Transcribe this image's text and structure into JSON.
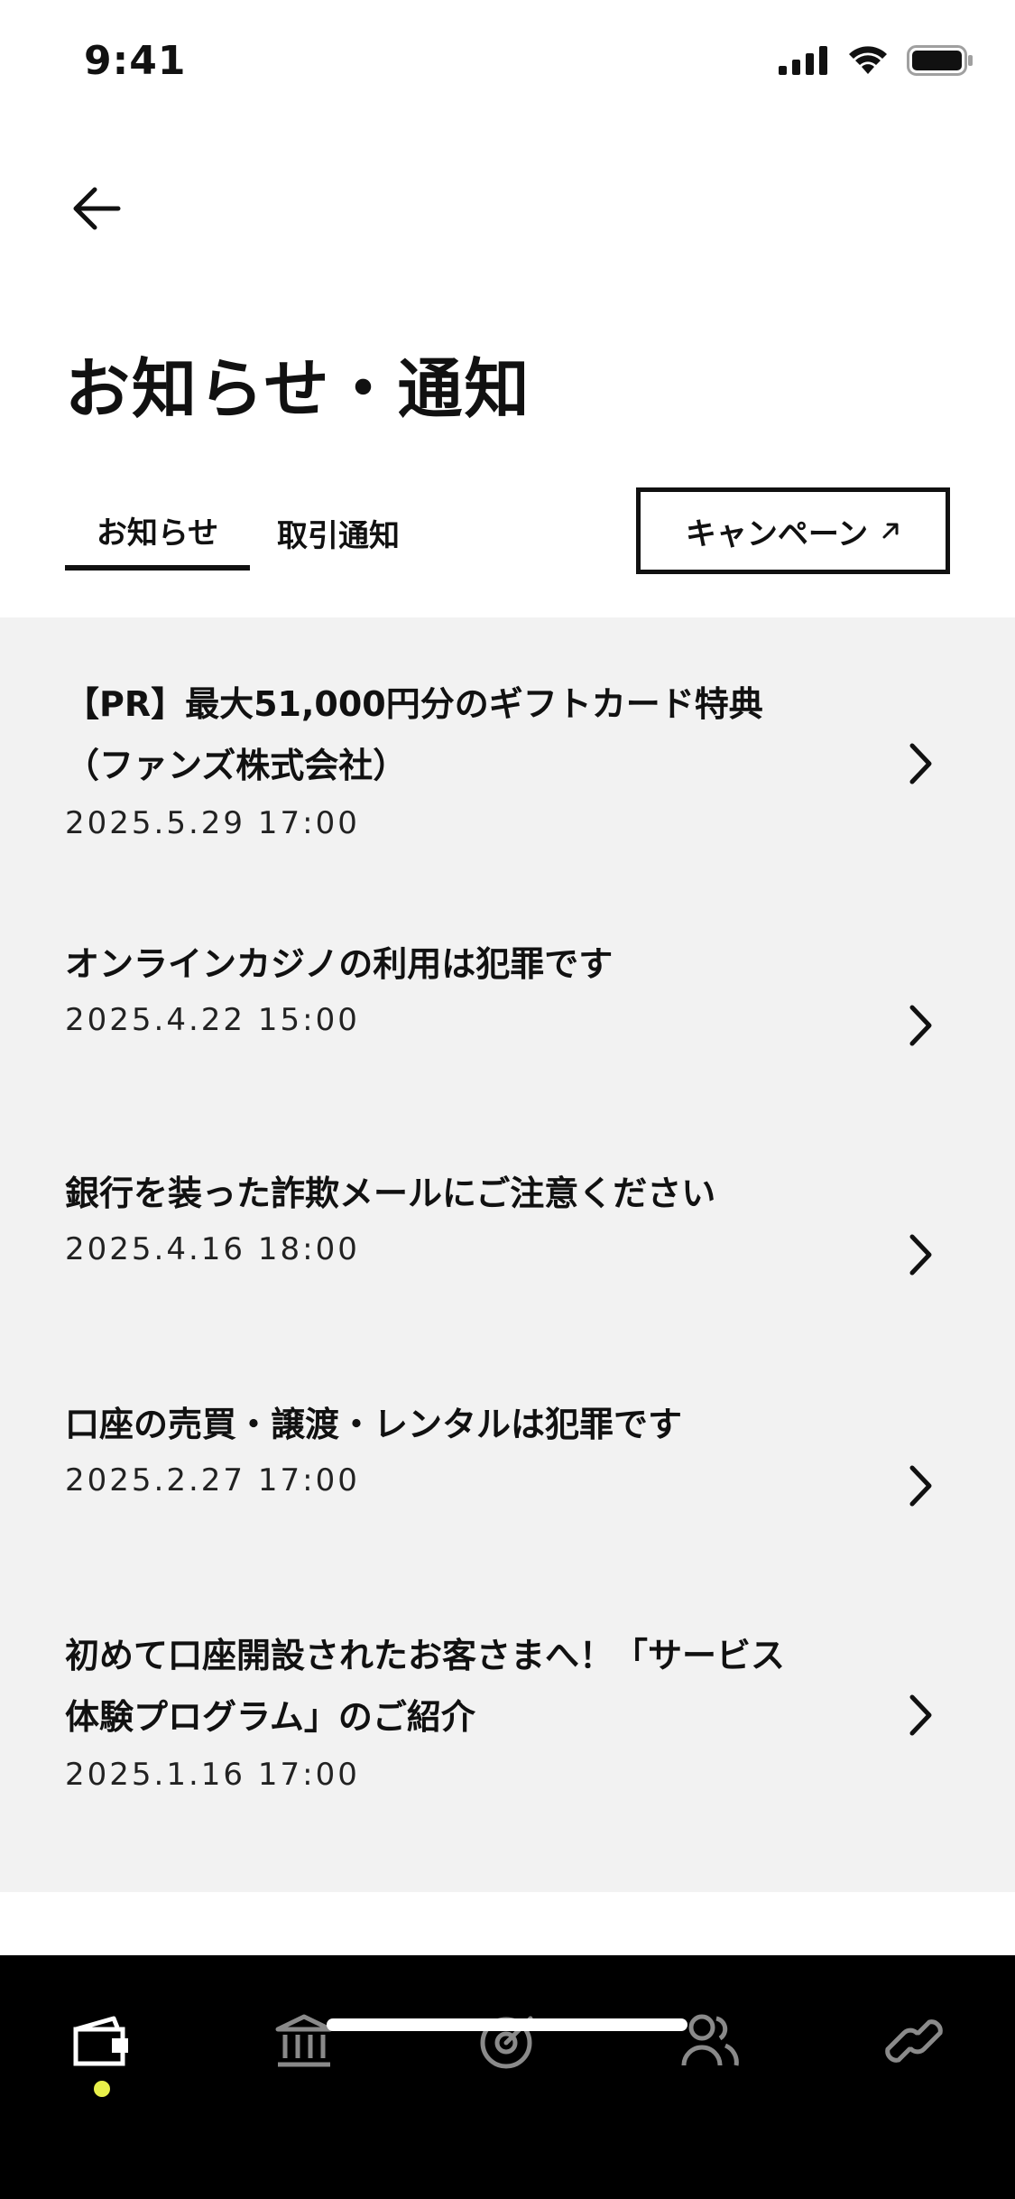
{
  "status_bar": {
    "time": "9:41"
  },
  "header": {
    "title": "お知らせ・通知"
  },
  "tabs": [
    {
      "label": "お知らせ",
      "active": true
    },
    {
      "label": "取引通知",
      "active": false
    }
  ],
  "campaign": {
    "label": "キャンペーン",
    "icon": "external-arrow-icon"
  },
  "news": [
    {
      "title": "【PR】最大51,000円分のギフトカード特典\n（ファンズ株式会社）",
      "date": "2025.5.29 17:00"
    },
    {
      "title": "オンラインカジノの利用は犯罪です",
      "date": "2025.4.22 15:00"
    },
    {
      "title": "銀行を装った詐欺メールにご注意ください",
      "date": "2025.4.16 18:00"
    },
    {
      "title": "口座の売買・譲渡・レンタルは犯罪です",
      "date": "2025.2.27 17:00"
    },
    {
      "title": "初めて口座開設されたお客さまへ！「サービス\n体験プログラム」のご紹介",
      "date": "2025.1.16 17:00"
    }
  ],
  "bottom_nav": {
    "items": [
      "wallet-icon",
      "bank-icon",
      "target-icon",
      "people-icon",
      "link-icon"
    ],
    "active_index": 0,
    "colors": {
      "active": "#ffffff",
      "inactive": "#8a8a8a",
      "dot": "#e8f04a",
      "background": "#000000"
    }
  }
}
